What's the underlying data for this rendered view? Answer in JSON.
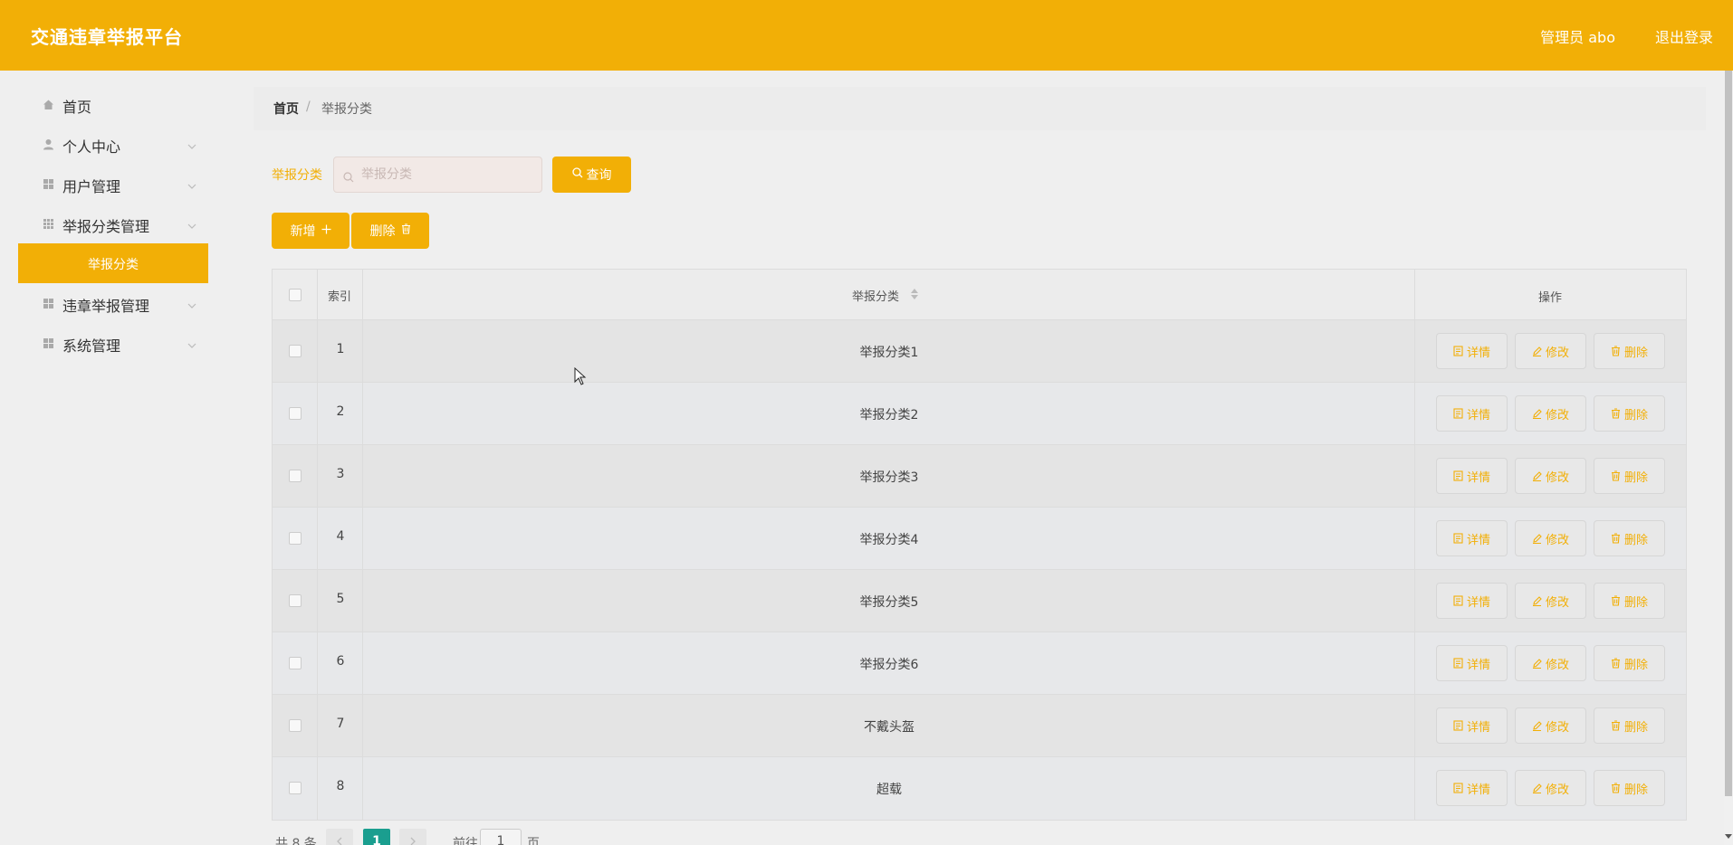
{
  "app": {
    "title": "交通违章举报平台"
  },
  "header": {
    "user_label": "管理员 abo",
    "logout_label": "退出登录"
  },
  "sidebar": {
    "items": [
      {
        "label": "首页",
        "icon": "home-icon"
      },
      {
        "label": "个人中心",
        "icon": "user-icon"
      },
      {
        "label": "用户管理",
        "icon": "grid-icon"
      },
      {
        "label": "举报分类管理",
        "icon": "grid-icon"
      },
      {
        "label": "违章举报管理",
        "icon": "grid-icon"
      },
      {
        "label": "系统管理",
        "icon": "grid-icon"
      }
    ],
    "active_sub_label": "举报分类"
  },
  "breadcrumb": {
    "home": "首页",
    "separator": "/",
    "current": "举报分类"
  },
  "filter": {
    "label": "举报分类",
    "placeholder": "举报分类",
    "query_label": "查询"
  },
  "actions": {
    "add_label": "新增",
    "delete_label": "删除"
  },
  "table": {
    "headers": {
      "index": "索引",
      "category": "举报分类",
      "operation": "操作"
    },
    "ops": {
      "detail": "详情",
      "edit": "修改",
      "delete": "删除"
    },
    "rows": [
      {
        "index": "1",
        "category": "举报分类1"
      },
      {
        "index": "2",
        "category": "举报分类2"
      },
      {
        "index": "3",
        "category": "举报分类3"
      },
      {
        "index": "4",
        "category": "举报分类4"
      },
      {
        "index": "5",
        "category": "举报分类5"
      },
      {
        "index": "6",
        "category": "举报分类6"
      },
      {
        "index": "7",
        "category": "不戴头盔"
      },
      {
        "index": "8",
        "category": "超载"
      }
    ]
  },
  "pagination": {
    "total": "共 8 条",
    "current_page": "1",
    "goto_label": "前往",
    "goto_value": "1",
    "page_suffix": "页"
  },
  "colors": {
    "accent": "#f2af06",
    "pagination_active": "#1a9e8f"
  }
}
